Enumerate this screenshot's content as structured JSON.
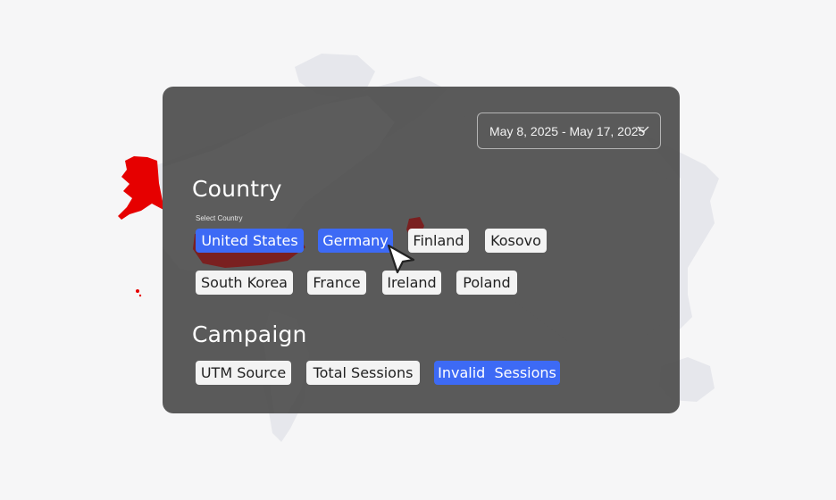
{
  "date_range": {
    "label": "May 8, 2025 - May 17, 2025",
    "icon": "chevron-down-icon"
  },
  "country": {
    "title": "Country",
    "sub_label": "Select Country",
    "chips": [
      {
        "label": "United States",
        "selected": true
      },
      {
        "label": "Germany",
        "selected": true
      },
      {
        "label": "Finland",
        "selected": false
      },
      {
        "label": "Kosovo",
        "selected": false
      },
      {
        "label": "South Korea",
        "selected": false
      },
      {
        "label": "France",
        "selected": false
      },
      {
        "label": "Ireland",
        "selected": false
      },
      {
        "label": "Poland",
        "selected": false
      }
    ]
  },
  "campaign": {
    "title": "Campaign",
    "chips": [
      {
        "label": "UTM Source",
        "selected": false
      },
      {
        "label": "Total Sessions",
        "selected": false
      },
      {
        "label": "Invalid  Sessions",
        "selected": true
      }
    ]
  },
  "colors": {
    "selected_chip": "#3d6af5",
    "unselected_chip": "#f3f3f3",
    "highlight_country": "#e60000",
    "panel": "#4e4e4e",
    "map_land": "#e4e5ea"
  }
}
